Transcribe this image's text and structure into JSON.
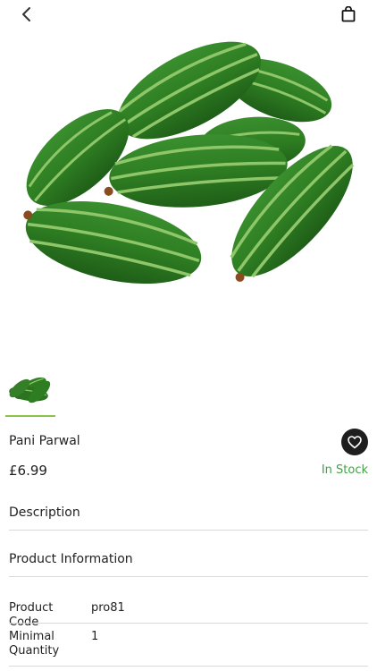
{
  "header": {
    "back_icon": "chevron-left-icon",
    "bag_icon": "shopping-bag-icon"
  },
  "product": {
    "name": "Pani Parwal",
    "price": "£6.99",
    "stock_status": "In Stock",
    "favorite_icon": "heart-icon",
    "accent_color": "#43a047",
    "thumbnail_indicator_color": "#8bc34a"
  },
  "sections": {
    "description_label": "Description",
    "product_information_label": "Product Information"
  },
  "attributes": [
    {
      "label": "Product Code",
      "value": "pro81"
    },
    {
      "label": "Minimal Quantity",
      "value": "1"
    }
  ]
}
